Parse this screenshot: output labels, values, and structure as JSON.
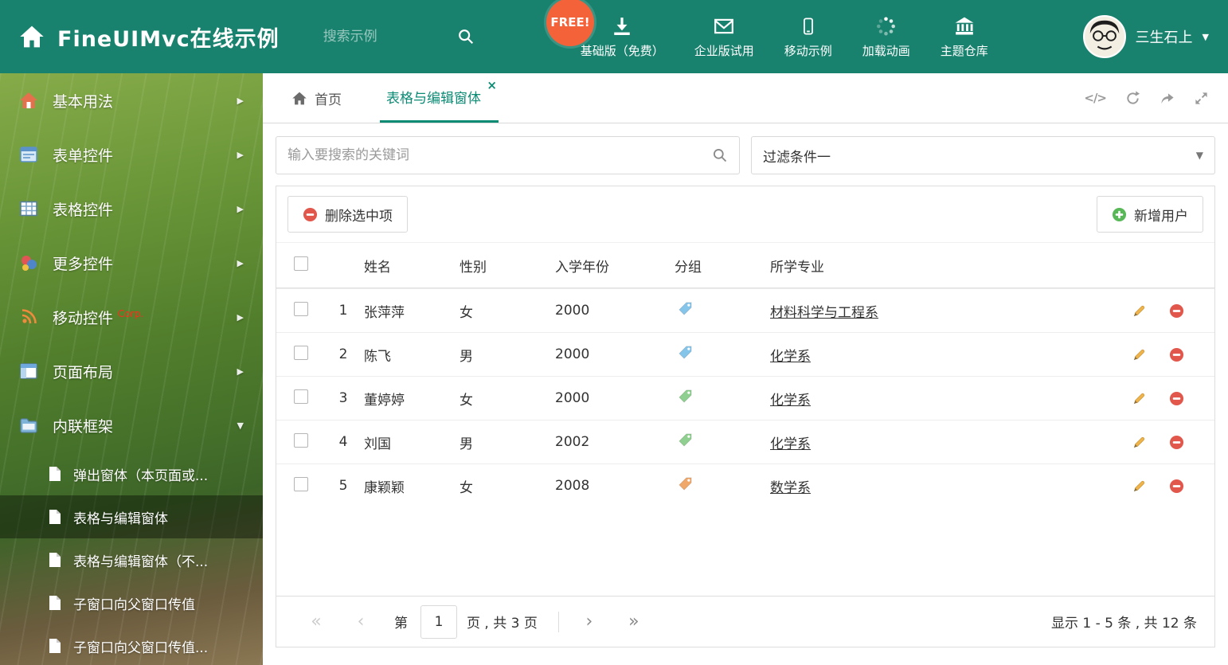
{
  "header": {
    "title": "FineUIMvc在线示例",
    "search_placeholder": "搜索示例",
    "free_badge": "FREE!",
    "nav_items": [
      {
        "label": "基础版（免费）",
        "icon": "download-icon"
      },
      {
        "label": "企业版试用",
        "icon": "envelope-icon"
      },
      {
        "label": "移动示例",
        "icon": "mobile-icon"
      },
      {
        "label": "加载动画",
        "icon": "spinner-icon"
      },
      {
        "label": "主题仓库",
        "icon": "bank-icon"
      }
    ],
    "user_name": "三生石上"
  },
  "sidebar": {
    "items": [
      {
        "label": "基本用法"
      },
      {
        "label": "表单控件"
      },
      {
        "label": "表格控件"
      },
      {
        "label": "更多控件"
      },
      {
        "label": "移动控件",
        "badge": "Corp."
      },
      {
        "label": "页面布局"
      },
      {
        "label": "内联框架"
      }
    ],
    "subitems": [
      {
        "label": "弹出窗体（本页面或..."
      },
      {
        "label": "表格与编辑窗体"
      },
      {
        "label": "表格与编辑窗体（不..."
      },
      {
        "label": "子窗口向父窗口传值"
      },
      {
        "label": "子窗口向父窗口传值..."
      }
    ]
  },
  "tabs": {
    "home_label": "首页",
    "active_label": "表格与编辑窗体"
  },
  "filter": {
    "search_placeholder": "输入要搜索的关键词",
    "dropdown_value": "过滤条件一"
  },
  "grid": {
    "delete_button": "删除选中项",
    "add_button": "新增用户",
    "columns": [
      "姓名",
      "性别",
      "入学年份",
      "分组",
      "所学专业"
    ],
    "rows": [
      {
        "num": "1",
        "name": "张萍萍",
        "gender": "女",
        "year": "2000",
        "tag_color": "#86c5ea",
        "major": "材料科学与工程系"
      },
      {
        "num": "2",
        "name": "陈飞",
        "gender": "男",
        "year": "2000",
        "tag_color": "#86c5ea",
        "major": "化学系"
      },
      {
        "num": "3",
        "name": "董婷婷",
        "gender": "女",
        "year": "2000",
        "tag_color": "#8fcf8f",
        "major": "化学系"
      },
      {
        "num": "4",
        "name": "刘国",
        "gender": "男",
        "year": "2002",
        "tag_color": "#8fcf8f",
        "major": "化学系"
      },
      {
        "num": "5",
        "name": "康颖颖",
        "gender": "女",
        "year": "2008",
        "tag_color": "#f0a86a",
        "major": "数学系"
      }
    ]
  },
  "pagination": {
    "first": "«",
    "prev": "‹",
    "next": "›",
    "last": "»",
    "page_prefix": "第",
    "current_page": "1",
    "page_suffix": "页 , 共 3 页",
    "summary": "显示 1 - 5 条 , 共 12 条"
  },
  "colors": {
    "header_bg": "#19826e",
    "accent": "#0c8b74",
    "delete_red": "#e2574c",
    "add_green": "#58b857",
    "free_orange": "#f4623a"
  }
}
